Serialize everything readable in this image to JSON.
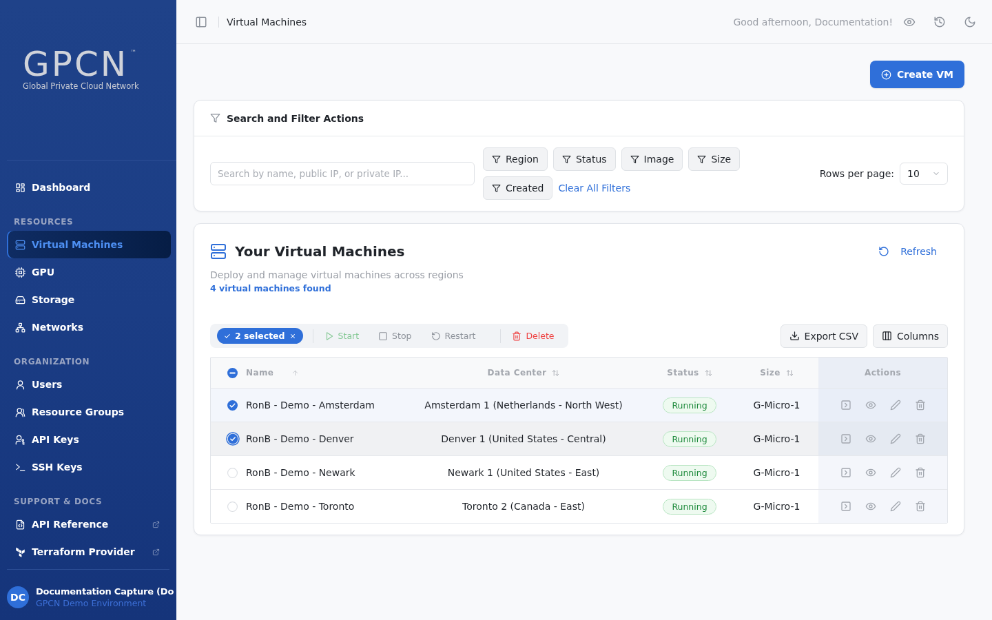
{
  "sidebar": {
    "logo": {
      "wordmark": "GPCN",
      "trademark": "™",
      "tagline": "Global Private Cloud Network"
    },
    "sections": [
      {
        "items": [
          {
            "label": "Dashboard",
            "selected": false,
            "external": false
          }
        ]
      },
      {
        "heading": "RESOURCES",
        "items": [
          {
            "label": "Virtual Machines",
            "selected": true,
            "external": false
          },
          {
            "label": "GPU",
            "selected": false,
            "external": false
          },
          {
            "label": "Storage",
            "selected": false,
            "external": false
          },
          {
            "label": "Networks",
            "selected": false,
            "external": false
          }
        ]
      },
      {
        "heading": "ORGANIZATION",
        "items": [
          {
            "label": "Users",
            "selected": false,
            "external": false
          },
          {
            "label": "Resource Groups",
            "selected": false,
            "external": false
          },
          {
            "label": "API Keys",
            "selected": false,
            "external": false
          },
          {
            "label": "SSH Keys",
            "selected": false,
            "external": false
          }
        ]
      },
      {
        "heading": "SUPPORT & DOCS",
        "items": [
          {
            "label": "API Reference",
            "selected": false,
            "external": true
          },
          {
            "label": "Terraform Provider",
            "selected": false,
            "external": true
          }
        ]
      }
    ],
    "user": {
      "initials": "DC",
      "name": "Documentation Capture (Do",
      "environment": "GPCN Demo Environment"
    }
  },
  "header": {
    "page_title": "Virtual Machines",
    "greeting": "Good afternoon, Documentation!"
  },
  "create_button": "Create VM",
  "filter_panel": {
    "title": "Search and Filter Actions",
    "search": {
      "placeholder": "Search by name, public IP, or private IP..."
    },
    "filters": [
      "Region",
      "Status",
      "Image",
      "Size",
      "Created"
    ],
    "clear_link": "Clear All Filters",
    "rows_per_page": {
      "label": "Rows per page:",
      "value": "10"
    }
  },
  "vm_panel": {
    "title": "Your Virtual Machines",
    "refresh": "Refresh",
    "subtitle": "Deploy and manage virtual machines across regions",
    "count": "4 virtual machines found",
    "bulk_bar": {
      "selection": "2 selected",
      "actions": [
        {
          "label": "Start",
          "kind": "start"
        },
        {
          "label": "Stop",
          "kind": "stop"
        },
        {
          "label": "Restart",
          "kind": "restart"
        },
        {
          "label": "Delete",
          "kind": "delete"
        }
      ]
    },
    "export_button": "Export CSV",
    "columns_button": "Columns",
    "table": {
      "select_all": {
        "checked": false,
        "indeterminate": true
      },
      "columns": [
        {
          "label": "Name",
          "sortable": true,
          "sorted": true
        },
        {
          "label": "Data Center",
          "sortable": true,
          "sorted": false
        },
        {
          "label": "Status",
          "sortable": true,
          "sorted": false
        },
        {
          "label": "Size",
          "sortable": true,
          "sorted": false
        },
        {
          "label": "Actions",
          "sortable": false,
          "sorted": false
        }
      ],
      "rows": [
        {
          "selected": true,
          "focused": false,
          "name": "RonB - Demo - Amsterdam",
          "data_center": "Amsterdam 1 (Netherlands - North West)",
          "status": "Running",
          "size": "G-Micro-1"
        },
        {
          "selected": true,
          "focused": true,
          "name": "RonB - Demo - Denver",
          "data_center": "Denver 1 (United States - Central)",
          "status": "Running",
          "size": "G-Micro-1"
        },
        {
          "selected": false,
          "focused": false,
          "name": "RonB - Demo - Newark",
          "data_center": "Newark 1 (United States - East)",
          "status": "Running",
          "size": "G-Micro-1"
        },
        {
          "selected": false,
          "focused": false,
          "name": "RonB - Demo - Toronto",
          "data_center": "Toronto 2 (Canada - East)",
          "status": "Running",
          "size": "G-Micro-1"
        }
      ]
    }
  }
}
